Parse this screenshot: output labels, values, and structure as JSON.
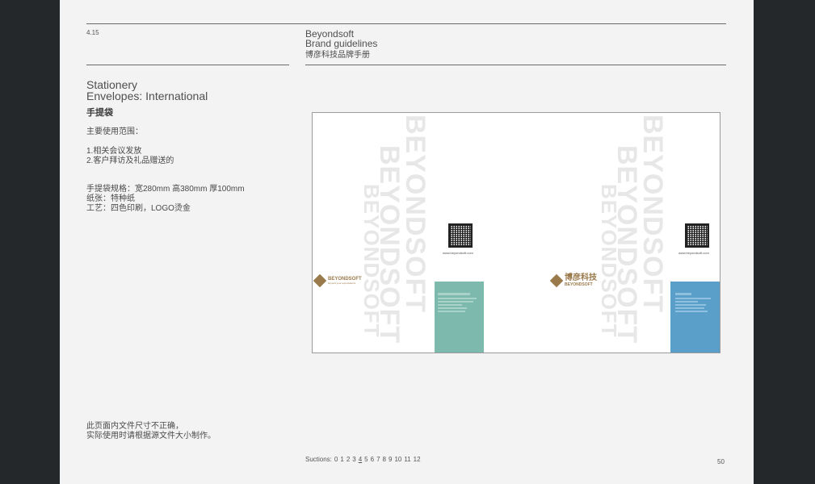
{
  "header": {
    "section_number": "4.15",
    "brand_name": "Beyondsoft",
    "brand_subtitle": "Brand guidelines",
    "brand_cn": "博彦科技品牌手册"
  },
  "content": {
    "category": "Stationery",
    "subtitle": "Envelopes: International",
    "heading_cn": "手提袋",
    "usage_title": "主要使用范围：",
    "usage_items": [
      "1.相关会议发放",
      "2.客户拜访及礼品赠送的"
    ],
    "specs": [
      "手提袋规格：宽280mm 高380mm 厚100mm",
      "纸张：特种纸",
      "工艺：四色印刷，LOGO烫金"
    ],
    "note": [
      "此页面内文件尺寸不正确，",
      "实际使用时请根据源文件大小制作。"
    ]
  },
  "artwork": {
    "watermark": "BEYONDSOFT",
    "url": "www.beyondsoft.com",
    "logo_en": "BEYONDSOFT",
    "tagline": "beyond your expectations",
    "logo_cn": "博彦科技",
    "teal_panel_color": "#7db9ac",
    "blue_panel_color": "#5a9fca"
  },
  "footer": {
    "sections_label": "Suctions:",
    "sections": [
      "0",
      "1",
      "2",
      "3",
      "4",
      "5",
      "6",
      "7",
      "8",
      "9",
      "10",
      "11",
      "12"
    ],
    "active_section": "4",
    "page_number": "50"
  }
}
